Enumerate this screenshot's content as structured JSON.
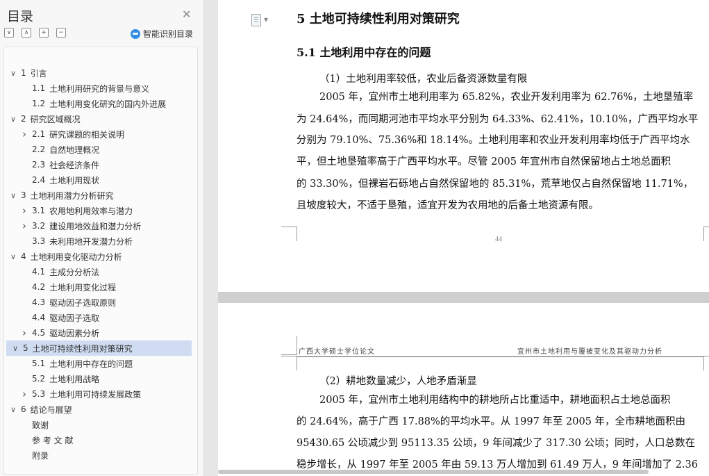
{
  "sidebar": {
    "title": "目录",
    "smart_label": "智能识别目录",
    "tools": [
      "∨",
      "∧",
      "+",
      "−"
    ],
    "toc": [
      {
        "level": 1,
        "expand": "v",
        "num": "1",
        "label": "引言",
        "selected": false
      },
      {
        "level": 2,
        "expand": "",
        "num": "1.1",
        "label": "土地利用研究的背景与意义",
        "selected": false
      },
      {
        "level": 2,
        "expand": "",
        "num": "1.2",
        "label": "土地利用变化研究的国内外进展",
        "selected": false
      },
      {
        "level": 1,
        "expand": "v",
        "num": "2",
        "label": "研究区域概况",
        "selected": false
      },
      {
        "level": 2,
        "expand": ">",
        "num": "2.1",
        "label": "研究课题的相关说明",
        "selected": false
      },
      {
        "level": 2,
        "expand": "",
        "num": "2.2",
        "label": "自然地理概况",
        "selected": false
      },
      {
        "level": 2,
        "expand": "",
        "num": "2.3",
        "label": "社会经济条件",
        "selected": false
      },
      {
        "level": 2,
        "expand": "",
        "num": "2.4",
        "label": "土地利用现状",
        "selected": false
      },
      {
        "level": 1,
        "expand": "v",
        "num": "3",
        "label": "土地利用潜力分析研究",
        "selected": false
      },
      {
        "level": 2,
        "expand": ">",
        "num": "3.1",
        "label": "农用地利用效率与潜力",
        "selected": false
      },
      {
        "level": 2,
        "expand": ">",
        "num": "3.2",
        "label": "建设用地效益和潜力分析",
        "selected": false
      },
      {
        "level": 2,
        "expand": "",
        "num": "3.3",
        "label": "未利用地开发潜力分析",
        "selected": false
      },
      {
        "level": 1,
        "expand": "v",
        "num": "4",
        "label": "土地利用变化驱动力分析",
        "selected": false
      },
      {
        "level": 2,
        "expand": "",
        "num": "4.1",
        "label": "主成分分析法",
        "selected": false
      },
      {
        "level": 2,
        "expand": "",
        "num": "4.2",
        "label": "土地利用变化过程",
        "selected": false
      },
      {
        "level": 2,
        "expand": "",
        "num": "4.3",
        "label": "驱动因子选取原则",
        "selected": false
      },
      {
        "level": 2,
        "expand": "",
        "num": "4.4",
        "label": "驱动因子选取",
        "selected": false
      },
      {
        "level": 2,
        "expand": ">",
        "num": "4.5",
        "label": "驱动因素分析",
        "selected": false
      },
      {
        "level": 1,
        "expand": "v",
        "num": "5",
        "label": "土地可持续性利用对策研究",
        "selected": true
      },
      {
        "level": 2,
        "expand": "",
        "num": "5.1",
        "label": "土地利用中存在的问题",
        "selected": false
      },
      {
        "level": 2,
        "expand": "",
        "num": "5.2",
        "label": "土地利用战略",
        "selected": false
      },
      {
        "level": 2,
        "expand": ">",
        "num": "5.3",
        "label": "土地利用可持续发展政策",
        "selected": false
      },
      {
        "level": 1,
        "expand": "v",
        "num": "6",
        "label": "结论与展望",
        "selected": false
      },
      {
        "level": 2,
        "expand": "",
        "num": "",
        "label": "致谢",
        "selected": false
      },
      {
        "level": 2,
        "expand": "",
        "num": "",
        "label": "参 考 文 献",
        "selected": false
      },
      {
        "level": 2,
        "expand": "",
        "num": "",
        "label": "附录",
        "selected": false
      }
    ]
  },
  "doc": {
    "heading1": "5  土地可持续性利用对策研究",
    "heading2": "5.1  土地利用中存在的问题",
    "sub1": "（1）土地利用率较低，农业后备资源数量有限",
    "para1": [
      "2005 年，宜州市土地利用率为 65.82%，农业开发利用率为 62.76%，土地垦殖率",
      "为 24.64%，而同期河池市平均水平分别为 64.33%、62.41%，10.10%，广西平均水平",
      "分别为 79.10%、75.36%和 18.14%。土地利用率和农业开发利用率均低于广西平均水",
      "平，但土地垦殖率高于广西平均水平。尽管 2005 年宜州市自然保留地占土地总面积",
      "的 33.30%，但裸岩石砾地占自然保留地的 85.31%，荒草地仅占自然保留地 11.71%，",
      "且坡度较大，不适于垦殖，适宜开发为农用地的后备土地资源有限。"
    ],
    "page_number": "44",
    "header_left": "广西大学硕士学位论文",
    "header_right": "宜州市土地利用与覆被变化及其驱动力分析",
    "sub2": "（2）耕地数量减少，人地矛盾渐显",
    "para2": [
      "2005 年，宜州市土地利用结构中的耕地所占比重适中，耕地面积占土地总面积",
      "的 24.64%，高于广西 17.88%的平均水平。从 1997 年至 2005 年，全市耕地面积由",
      "95430.65 公顷减少到 95113.35 公顷，9 年间减少了 317.30 公顷；同时，人口总数在",
      "稳步增长，从 1997 年至 2005 年由 59.13 万人增加到 61.49 万人，9 年间增加了 2.36"
    ]
  }
}
